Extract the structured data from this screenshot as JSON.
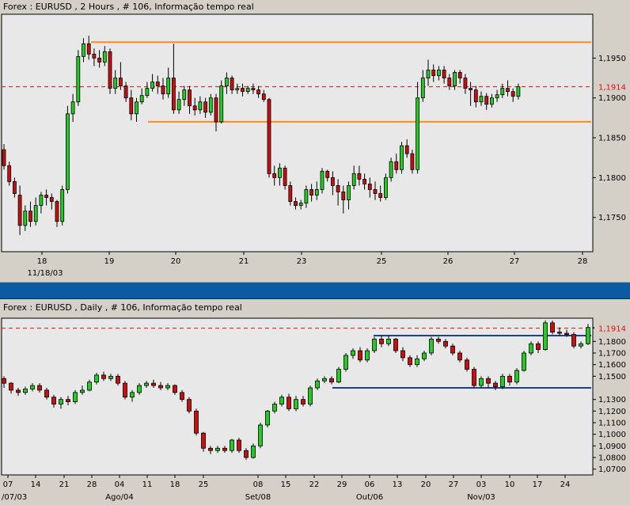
{
  "chart_data": [
    {
      "type": "candlestick",
      "title": "Forex : EURUSD , 2 Hours , # 106, Informação tempo real",
      "y_ticks": [
        "1,1950",
        "1,1900",
        "1,1850",
        "1,1800",
        "1,1750"
      ],
      "y_tick_values": [
        1.195,
        1.19,
        1.185,
        1.18,
        1.175
      ],
      "ylim": [
        1.1707,
        1.2005
      ],
      "current_price_label": "1,1914",
      "current_price": 1.1914,
      "x_ticks": [
        "18",
        "19",
        "20",
        "21",
        "23",
        "25",
        "26",
        "27",
        "28"
      ],
      "x_sub_label": "11/18/03",
      "horizontal_lines": [
        {
          "price": 1.197,
          "color": "#ff8c1a"
        },
        {
          "price": 1.187,
          "color": "#ff8c1a"
        }
      ],
      "candles": [
        [
          1.1835,
          1.1815,
          1.1842,
          1.181
        ],
        [
          1.1815,
          1.1795,
          1.182,
          1.179
        ],
        [
          1.1795,
          1.178,
          1.18,
          1.1775
        ],
        [
          1.1778,
          1.174,
          1.179,
          1.1728
        ],
        [
          1.174,
          1.1758,
          1.1765,
          1.1733
        ],
        [
          1.1758,
          1.1745,
          1.177,
          1.1738
        ],
        [
          1.1745,
          1.1765,
          1.1775,
          1.174
        ],
        [
          1.1765,
          1.1778,
          1.1782,
          1.1755
        ],
        [
          1.1778,
          1.1775,
          1.1785,
          1.1765
        ],
        [
          1.1775,
          1.177,
          1.178,
          1.176
        ],
        [
          1.177,
          1.1745,
          1.1772,
          1.1738
        ],
        [
          1.1745,
          1.1785,
          1.179,
          1.174
        ],
        [
          1.1785,
          1.188,
          1.189,
          1.178
        ],
        [
          1.188,
          1.1895,
          1.1905,
          1.187
        ],
        [
          1.1895,
          1.1952,
          1.196,
          1.189
        ],
        [
          1.1952,
          1.1968,
          1.1975,
          1.1945
        ],
        [
          1.1968,
          1.1955,
          1.1978,
          1.1948
        ],
        [
          1.1955,
          1.195,
          1.1962,
          1.194
        ],
        [
          1.195,
          1.1945,
          1.196,
          1.1938
        ],
        [
          1.1945,
          1.1958,
          1.1965,
          1.194
        ],
        [
          1.1958,
          1.1912,
          1.1962,
          1.1905
        ],
        [
          1.1912,
          1.1925,
          1.1935,
          1.1905
        ],
        [
          1.1925,
          1.1915,
          1.1945,
          1.191
        ],
        [
          1.1915,
          1.19,
          1.192,
          1.1895
        ],
        [
          1.19,
          1.188,
          1.191,
          1.1872
        ],
        [
          1.188,
          1.1895,
          1.19,
          1.187
        ],
        [
          1.1895,
          1.1903,
          1.1912,
          1.1892
        ],
        [
          1.1903,
          1.1912,
          1.192,
          1.19
        ],
        [
          1.1912,
          1.192,
          1.193,
          1.1908
        ],
        [
          1.192,
          1.1915,
          1.1928,
          1.1905
        ],
        [
          1.1915,
          1.1905,
          1.1925,
          1.1898
        ],
        [
          1.1905,
          1.1925,
          1.1938,
          1.19
        ],
        [
          1.1925,
          1.1885,
          1.1968,
          1.188
        ],
        [
          1.1885,
          1.1898,
          1.1908,
          1.188
        ],
        [
          1.1898,
          1.191,
          1.1915,
          1.189
        ],
        [
          1.191,
          1.189,
          1.1915,
          1.188
        ],
        [
          1.189,
          1.1885,
          1.19,
          1.1878
        ],
        [
          1.1885,
          1.1895,
          1.1902,
          1.188
        ],
        [
          1.1895,
          1.1882,
          1.19,
          1.1875
        ],
        [
          1.1882,
          1.19,
          1.1905,
          1.1878
        ],
        [
          1.19,
          1.187,
          1.1905,
          1.1858
        ],
        [
          1.187,
          1.1915,
          1.1922,
          1.1868
        ],
        [
          1.1915,
          1.1925,
          1.1932,
          1.1905
        ],
        [
          1.1925,
          1.191,
          1.1928,
          1.1905
        ],
        [
          1.191,
          1.1912,
          1.1918,
          1.1905
        ],
        [
          1.1912,
          1.1908,
          1.1918,
          1.1902
        ],
        [
          1.1908,
          1.1912,
          1.1915,
          1.1905
        ],
        [
          1.1912,
          1.191,
          1.1918,
          1.1905
        ],
        [
          1.191,
          1.1905,
          1.1915,
          1.19
        ],
        [
          1.1905,
          1.1898,
          1.191,
          1.1895
        ],
        [
          1.1898,
          1.1805,
          1.19,
          1.18
        ],
        [
          1.1805,
          1.18,
          1.1815,
          1.179
        ],
        [
          1.18,
          1.1812,
          1.1818,
          1.179
        ],
        [
          1.1812,
          1.179,
          1.1815,
          1.1785
        ],
        [
          1.179,
          1.177,
          1.1795,
          1.1765
        ],
        [
          1.177,
          1.1765,
          1.1775,
          1.176
        ],
        [
          1.1765,
          1.1768,
          1.1772,
          1.176
        ],
        [
          1.1768,
          1.1785,
          1.179,
          1.1762
        ],
        [
          1.1785,
          1.1778,
          1.1792,
          1.177
        ],
        [
          1.1778,
          1.1785,
          1.1795,
          1.1772
        ],
        [
          1.1785,
          1.1808,
          1.1812,
          1.178
        ],
        [
          1.1808,
          1.18,
          1.181,
          1.1795
        ],
        [
          1.18,
          1.179,
          1.1808,
          1.1778
        ],
        [
          1.179,
          1.1782,
          1.1798,
          1.1765
        ],
        [
          1.1782,
          1.1772,
          1.179,
          1.1755
        ],
        [
          1.1772,
          1.179,
          1.1795,
          1.176
        ],
        [
          1.179,
          1.1805,
          1.1815,
          1.1785
        ],
        [
          1.1805,
          1.1798,
          1.1815,
          1.179
        ],
        [
          1.1798,
          1.1792,
          1.1805,
          1.1785
        ],
        [
          1.1792,
          1.1785,
          1.18,
          1.1775
        ],
        [
          1.1785,
          1.178,
          1.1795,
          1.1772
        ],
        [
          1.178,
          1.1775,
          1.179,
          1.177
        ],
        [
          1.1775,
          1.18,
          1.1805,
          1.1772
        ],
        [
          1.18,
          1.182,
          1.1825,
          1.1795
        ],
        [
          1.182,
          1.181,
          1.183,
          1.1805
        ],
        [
          1.181,
          1.184,
          1.1845,
          1.1805
        ],
        [
          1.184,
          1.183,
          1.1848,
          1.1825
        ],
        [
          1.183,
          1.181,
          1.1835,
          1.1805
        ],
        [
          1.181,
          1.19,
          1.192,
          1.1805
        ],
        [
          1.19,
          1.1925,
          1.1935,
          1.1895
        ],
        [
          1.1925,
          1.1935,
          1.1948,
          1.1915
        ],
        [
          1.1935,
          1.1928,
          1.1942,
          1.192
        ],
        [
          1.1928,
          1.1935,
          1.194,
          1.1922
        ],
        [
          1.1935,
          1.1925,
          1.194,
          1.1918
        ],
        [
          1.1925,
          1.1915,
          1.193,
          1.191
        ],
        [
          1.1915,
          1.1932,
          1.1935,
          1.191
        ],
        [
          1.1932,
          1.1925,
          1.1935,
          1.1918
        ],
        [
          1.1925,
          1.1912,
          1.193,
          1.1905
        ],
        [
          1.1912,
          1.191,
          1.192,
          1.189
        ],
        [
          1.191,
          1.1895,
          1.1915,
          1.1888
        ],
        [
          1.1895,
          1.1902,
          1.1908,
          1.189
        ],
        [
          1.1902,
          1.1892,
          1.1906,
          1.1885
        ],
        [
          1.1892,
          1.19,
          1.1905,
          1.1888
        ],
        [
          1.19,
          1.1904,
          1.191,
          1.1895
        ],
        [
          1.1904,
          1.1912,
          1.1918,
          1.19
        ],
        [
          1.1912,
          1.1908,
          1.1922,
          1.1902
        ],
        [
          1.1908,
          1.1902,
          1.1912,
          1.1895
        ],
        [
          1.1902,
          1.1914,
          1.1918,
          1.1898
        ]
      ]
    },
    {
      "type": "candlestick",
      "title": "Forex : EURUSD , Daily , # 106, Informação tempo real",
      "y_ticks": [
        "1,1800",
        "1,1700",
        "1,1600",
        "1,1500",
        "1,1300",
        "1,1200",
        "1,1100",
        "1,1000",
        "1,0900",
        "1,0800",
        "1,0700"
      ],
      "y_tick_values": [
        1.18,
        1.17,
        1.16,
        1.15,
        1.13,
        1.12,
        1.11,
        1.1,
        1.09,
        1.08,
        1.07
      ],
      "ylim": [
        1.065,
        1.2
      ],
      "current_price_label": "1,1914",
      "current_price": 1.1914,
      "x_ticks": [
        "07",
        "14",
        "21",
        "28",
        "04",
        "11",
        "18",
        "25",
        "08",
        "15",
        "22",
        "29",
        "06",
        "13",
        "20",
        "27",
        "03",
        "10",
        "17",
        "24"
      ],
      "x_sub_labels": [
        "/07/03",
        "Ago/04",
        "Set/08",
        "Out/06",
        "Nov/03"
      ],
      "horizontal_lines": [
        {
          "price": 1.185,
          "color": "#1f3f8f"
        },
        {
          "price": 1.14,
          "color": "#1f3f8f"
        }
      ],
      "candles": [
        [
          1.148,
          1.144,
          1.15,
          1.14
        ],
        [
          1.144,
          1.138,
          1.145,
          1.135
        ],
        [
          1.138,
          1.136,
          1.14,
          1.133
        ],
        [
          1.136,
          1.139,
          1.141,
          1.134
        ],
        [
          1.139,
          1.142,
          1.144,
          1.137
        ],
        [
          1.142,
          1.138,
          1.144,
          1.136
        ],
        [
          1.138,
          1.132,
          1.14,
          1.13
        ],
        [
          1.132,
          1.126,
          1.134,
          1.123
        ],
        [
          1.126,
          1.13,
          1.132,
          1.122
        ],
        [
          1.13,
          1.128,
          1.133,
          1.125
        ],
        [
          1.128,
          1.136,
          1.138,
          1.126
        ],
        [
          1.136,
          1.138,
          1.142,
          1.134
        ],
        [
          1.138,
          1.145,
          1.147,
          1.137
        ],
        [
          1.145,
          1.151,
          1.153,
          1.143
        ],
        [
          1.151,
          1.148,
          1.154,
          1.146
        ],
        [
          1.148,
          1.15,
          1.152,
          1.146
        ],
        [
          1.15,
          1.144,
          1.152,
          1.142
        ],
        [
          1.144,
          1.132,
          1.146,
          1.13
        ],
        [
          1.132,
          1.136,
          1.138,
          1.128
        ],
        [
          1.136,
          1.142,
          1.144,
          1.134
        ],
        [
          1.142,
          1.144,
          1.146,
          1.14
        ],
        [
          1.144,
          1.142,
          1.147,
          1.14
        ],
        [
          1.142,
          1.14,
          1.145,
          1.138
        ],
        [
          1.14,
          1.142,
          1.144,
          1.138
        ],
        [
          1.142,
          1.136,
          1.143,
          1.134
        ],
        [
          1.136,
          1.13,
          1.138,
          1.128
        ],
        [
          1.13,
          1.12,
          1.132,
          1.118
        ],
        [
          1.12,
          1.101,
          1.122,
          1.099
        ],
        [
          1.101,
          1.088,
          1.102,
          1.085
        ],
        [
          1.088,
          1.086,
          1.09,
          1.083
        ],
        [
          1.086,
          1.088,
          1.09,
          1.084
        ],
        [
          1.088,
          1.086,
          1.09,
          1.084
        ],
        [
          1.086,
          1.095,
          1.096,
          1.084
        ],
        [
          1.095,
          1.086,
          1.097,
          1.084
        ],
        [
          1.086,
          1.08,
          1.088,
          1.078
        ],
        [
          1.08,
          1.09,
          1.092,
          1.079
        ],
        [
          1.09,
          1.108,
          1.11,
          1.088
        ],
        [
          1.108,
          1.12,
          1.121,
          1.106
        ],
        [
          1.12,
          1.126,
          1.128,
          1.118
        ],
        [
          1.126,
          1.132,
          1.134,
          1.124
        ],
        [
          1.132,
          1.122,
          1.135,
          1.12
        ],
        [
          1.122,
          1.13,
          1.133,
          1.12
        ],
        [
          1.13,
          1.126,
          1.133,
          1.124
        ],
        [
          1.126,
          1.14,
          1.142,
          1.124
        ],
        [
          1.14,
          1.146,
          1.148,
          1.138
        ],
        [
          1.146,
          1.148,
          1.15,
          1.144
        ],
        [
          1.148,
          1.145,
          1.15,
          1.143
        ],
        [
          1.145,
          1.156,
          1.158,
          1.144
        ],
        [
          1.156,
          1.168,
          1.17,
          1.154
        ],
        [
          1.168,
          1.172,
          1.174,
          1.165
        ],
        [
          1.172,
          1.164,
          1.175,
          1.162
        ],
        [
          1.164,
          1.172,
          1.174,
          1.162
        ],
        [
          1.172,
          1.182,
          1.184,
          1.17
        ],
        [
          1.182,
          1.178,
          1.185,
          1.175
        ],
        [
          1.178,
          1.182,
          1.185,
          1.176
        ],
        [
          1.182,
          1.172,
          1.183,
          1.17
        ],
        [
          1.172,
          1.166,
          1.175,
          1.163
        ],
        [
          1.166,
          1.16,
          1.168,
          1.158
        ],
        [
          1.16,
          1.165,
          1.168,
          1.158
        ],
        [
          1.165,
          1.17,
          1.172,
          1.163
        ],
        [
          1.17,
          1.182,
          1.184,
          1.168
        ],
        [
          1.182,
          1.18,
          1.184,
          1.178
        ],
        [
          1.18,
          1.176,
          1.182,
          1.174
        ],
        [
          1.176,
          1.17,
          1.178,
          1.168
        ],
        [
          1.17,
          1.164,
          1.172,
          1.162
        ],
        [
          1.164,
          1.156,
          1.166,
          1.154
        ],
        [
          1.156,
          1.142,
          1.158,
          1.14
        ],
        [
          1.142,
          1.148,
          1.15,
          1.14
        ],
        [
          1.148,
          1.144,
          1.15,
          1.14
        ],
        [
          1.144,
          1.141,
          1.146,
          1.138
        ],
        [
          1.141,
          1.15,
          1.152,
          1.139
        ],
        [
          1.15,
          1.145,
          1.152,
          1.142
        ],
        [
          1.145,
          1.155,
          1.157,
          1.143
        ],
        [
          1.155,
          1.17,
          1.172,
          1.154
        ],
        [
          1.17,
          1.178,
          1.18,
          1.168
        ],
        [
          1.178,
          1.173,
          1.18,
          1.17
        ],
        [
          1.173,
          1.196,
          1.198,
          1.172
        ],
        [
          1.196,
          1.188,
          1.198,
          1.186
        ],
        [
          1.188,
          1.187,
          1.192,
          1.185
        ],
        [
          1.187,
          1.186,
          1.19,
          1.184
        ],
        [
          1.186,
          1.176,
          1.188,
          1.174
        ],
        [
          1.176,
          1.178,
          1.18,
          1.174
        ],
        [
          1.178,
          1.192,
          1.195,
          1.177
        ],
        [
          1.192,
          1.1914,
          1.194,
          1.19
        ]
      ]
    }
  ],
  "splitter_label": ""
}
